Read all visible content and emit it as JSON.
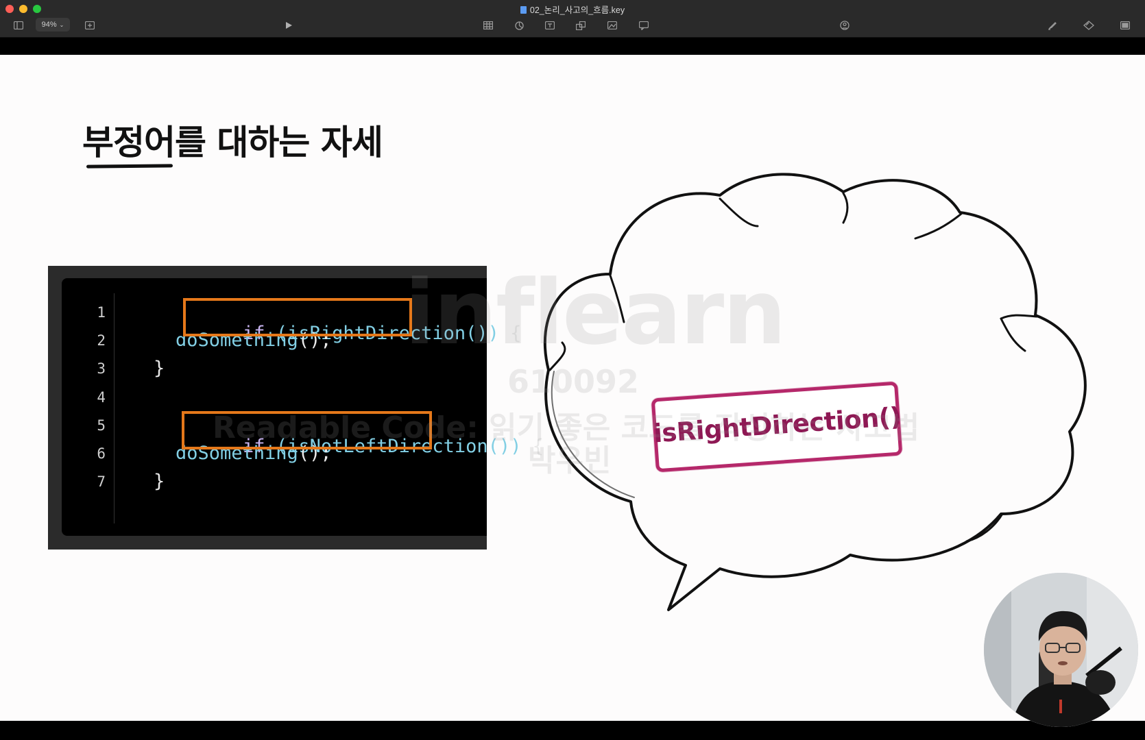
{
  "window": {
    "title": "02_논리_사고의_흐름.key",
    "zoom": "94%"
  },
  "toolbar": {
    "icons": [
      "sidebar-icon",
      "zoom-select",
      "add-slide-icon",
      "play-icon",
      "table-icon",
      "chart-icon",
      "text-icon",
      "shape-icon",
      "media-icon",
      "comment-icon",
      "collaborate-icon",
      "format-icon",
      "animate-icon",
      "document-icon"
    ]
  },
  "slide": {
    "title": "부정어를 대하는 자세",
    "code": {
      "line_numbers": [
        "1",
        "2",
        "3",
        "4",
        "5",
        "6",
        "7"
      ],
      "lines": [
        {
          "kw": "if",
          "cond": "(isRightDirection())",
          "tail": "{"
        },
        {
          "call": "doSomething",
          "tail": "();"
        },
        {
          "brace": "}"
        },
        {},
        {
          "kw": "if",
          "cond": "(isNotLeftDirection())",
          "tail": "{"
        },
        {
          "call": "doSomething",
          "tail": "();"
        },
        {
          "brace": "}"
        }
      ]
    },
    "thought_bubble_label": "isRightDirection()",
    "watermark": {
      "brand": "inflearn",
      "id": "610092",
      "course": "Readable Code: 읽기 좋은 코드를 작성하는 사고법",
      "author": "박우빈"
    }
  },
  "colors": {
    "highlight": "#e5781a",
    "label": "#8e1854",
    "keyword": "#c8b4f0",
    "function": "#82cfe4"
  }
}
